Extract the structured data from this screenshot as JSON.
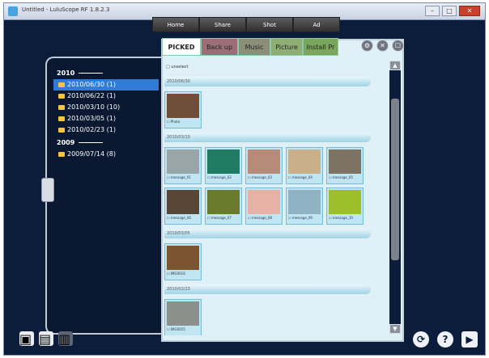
{
  "window": {
    "title": "Untitled - LuluScope RF 1.8.2.3"
  },
  "titlebar_buttons": [
    "–",
    "□",
    "✕"
  ],
  "top_nav": [
    "Home",
    "Share",
    "Shot",
    "Ad"
  ],
  "timeline": {
    "groups": [
      {
        "year": "2010",
        "dates": [
          {
            "label": "2010/06/30 (1)",
            "selected": true
          },
          {
            "label": "2010/06/22 (1)"
          },
          {
            "label": "2010/03/10 (10)"
          },
          {
            "label": "2010/03/05 (1)"
          },
          {
            "label": "2010/02/23 (1)"
          }
        ]
      },
      {
        "year": "2009",
        "dates": [
          {
            "label": "2009/07/14 (8)"
          }
        ]
      }
    ]
  },
  "tabs": [
    "PICKED",
    "Back up",
    "Music",
    "Picture",
    "Install Pr"
  ],
  "actions": [
    "⚙",
    "✕",
    "☐"
  ],
  "select_all": "□ unselect",
  "photo_groups": [
    {
      "date": "2010/06/30",
      "thumbs": [
        {
          "label": "☐ Photo",
          "color": "#6f4f3a"
        }
      ]
    },
    {
      "date": "2010/03/10",
      "thumbs": [
        {
          "label": "☐ message_01",
          "color": "#9aa5a9"
        },
        {
          "label": "☐ message_02",
          "color": "#1f7b64"
        },
        {
          "label": "☐ message_03",
          "color": "#b68b7a"
        },
        {
          "label": "☐ message_04",
          "color": "#c9b08a"
        },
        {
          "label": "☐ message_05",
          "color": "#7c7362"
        },
        {
          "label": "☐ message_06",
          "color": "#5a4636"
        },
        {
          "label": "☐ message_07",
          "color": "#6a7a2e"
        },
        {
          "label": "☐ message_08",
          "color": "#e6b2a5"
        },
        {
          "label": "☐ message_09",
          "color": "#8fb3c2"
        },
        {
          "label": "☐ message_10",
          "color": "#9dbf2c"
        }
      ]
    },
    {
      "date": "2010/03/05",
      "thumbs": [
        {
          "label": "☐ IMG0016",
          "color": "#7b5530"
        }
      ]
    },
    {
      "date": "2010/02/23",
      "thumbs": [
        {
          "label": "☐ IMG0015",
          "color": "#8c8f8c"
        }
      ]
    }
  ],
  "bottom_left": [
    "▣",
    "▤",
    "▥"
  ],
  "bottom_right": [
    "⟳",
    "?",
    "▶"
  ]
}
